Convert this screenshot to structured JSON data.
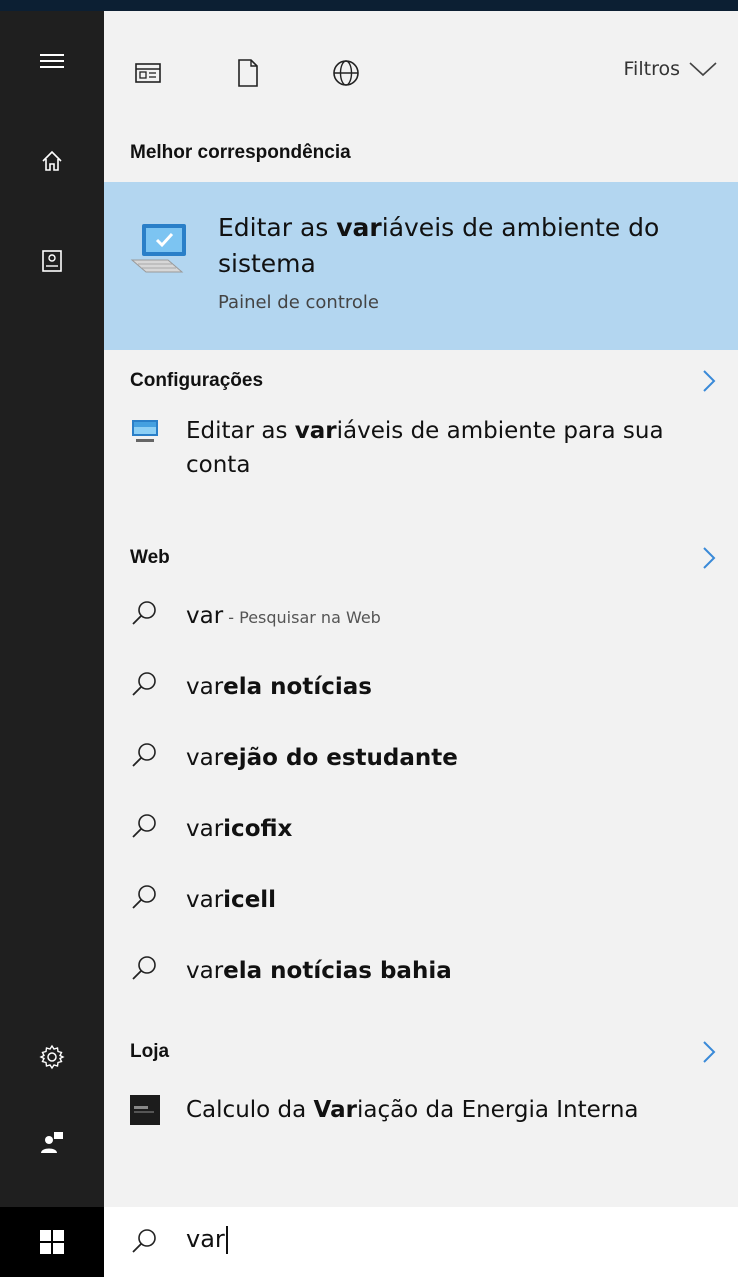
{
  "toolbar": {
    "filters_label": "Filtros"
  },
  "sections": {
    "best_match": "Melhor correspondência",
    "settings": "Configurações",
    "web": "Web",
    "store": "Loja"
  },
  "best_match": {
    "title_pre": "Editar as ",
    "title_bold": "var",
    "title_post": "iáveis de ambiente do sistema",
    "subtitle": "Painel de controle"
  },
  "settings_item": {
    "pre": "Editar as ",
    "bold": "var",
    "post": "iáveis de ambiente para sua conta"
  },
  "web_items": [
    {
      "plain": "var",
      "bold": "",
      "hint": " - Pesquisar na Web"
    },
    {
      "plain": "var",
      "bold": "ela notícias",
      "hint": ""
    },
    {
      "plain": "var",
      "bold": "ejão do estudante",
      "hint": ""
    },
    {
      "plain": "var",
      "bold": "icofix",
      "hint": ""
    },
    {
      "plain": "var",
      "bold": "icell",
      "hint": ""
    },
    {
      "plain": "var",
      "bold": "ela notícias bahia",
      "hint": ""
    }
  ],
  "store_item": {
    "pre": "Calculo da ",
    "bold": "Var",
    "post": "iação da Energia Interna"
  },
  "search": {
    "value": "var"
  },
  "colors": {
    "sidebar": "#1f1f1f",
    "highlight": "#b3d6f0",
    "accent": "#3a8ad8",
    "panel": "#f2f2f2"
  }
}
